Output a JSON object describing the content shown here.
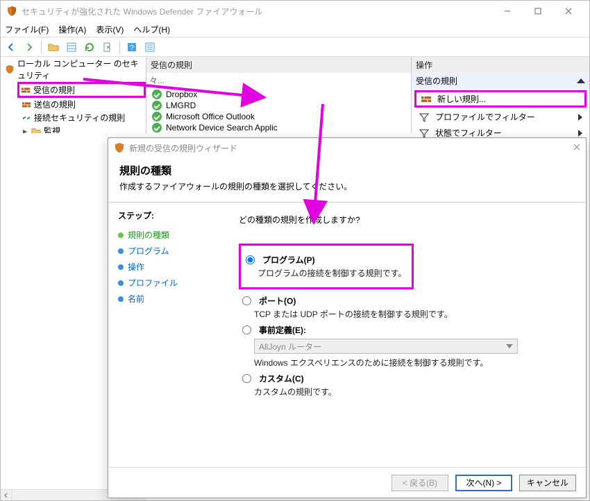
{
  "window": {
    "title": "セキュリティが強化された Windows Defender ファイアウォール"
  },
  "menus": {
    "file": "ファイル(F)",
    "action": "操作(A)",
    "view": "表示(V)",
    "help": "ヘルプ(H)"
  },
  "tree": {
    "root": "ローカル コンピューター のセキュリティ",
    "inbound": "受信の規則",
    "outbound": "送信の規則",
    "connsec": "接続セキュリティの規則",
    "monitor": "監視"
  },
  "rules_pane": {
    "header": "受信の規則",
    "truncated_header": "々...",
    "items": [
      "Dropbox",
      "LMGRD",
      "Microsoft Office Outlook",
      "Network Device Search Applic"
    ]
  },
  "ops_pane": {
    "header": "操作",
    "section": "受信の規則",
    "new_rule": "新しい規則...",
    "filter_profile": "プロファイルでフィルター",
    "filter_state": "状態でフィルター"
  },
  "wizard": {
    "title": "新規の受信の規則ウィザード",
    "heading": "規則の種類",
    "subheading": "作成するファイアウォールの規則の種類を選択してください。",
    "steps_title": "ステップ:",
    "steps": {
      "kind": "規則の種類",
      "program": "プログラム",
      "action": "操作",
      "profile": "プロファイル",
      "name": "名前"
    },
    "question": "どの種類の規則を作成しますか?",
    "opt_program": "プログラム(P)",
    "opt_program_desc": "プログラムの接続を制御する規則です。",
    "opt_port": "ポート(O)",
    "opt_port_desc": "TCP または UDP ポートの接続を制御する規則です。",
    "opt_predef": "事前定義(E):",
    "opt_predef_sel": "AllJoyn ルーター",
    "opt_predef_desc": "Windows エクスペリエンスのために接続を制御する規則です。",
    "opt_custom": "カスタム(C)",
    "opt_custom_desc": "カスタムの規則です。",
    "btn_back": "< 戻る(B)",
    "btn_next": "次へ(N) >",
    "btn_cancel": "キャンセル"
  }
}
